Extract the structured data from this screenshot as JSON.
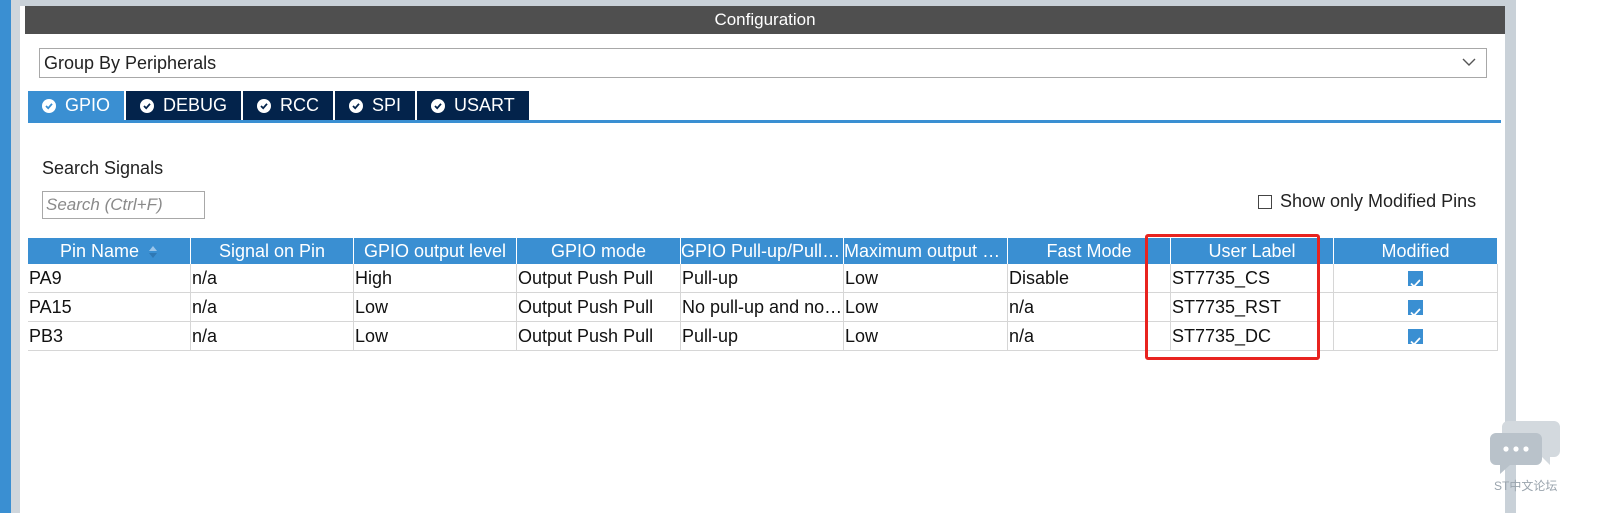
{
  "window": {
    "title": "Configuration"
  },
  "group_select": {
    "value": "Group By Peripherals"
  },
  "tabs": [
    {
      "label": "GPIO",
      "active": true
    },
    {
      "label": "DEBUG",
      "active": false
    },
    {
      "label": "RCC",
      "active": false
    },
    {
      "label": "SPI",
      "active": false
    },
    {
      "label": "USART",
      "active": false
    }
  ],
  "search": {
    "label": "Search Signals",
    "placeholder": "Search (Ctrl+F)"
  },
  "modified_only": {
    "label": "Show only Modified Pins",
    "checked": false
  },
  "table": {
    "columns": [
      "Pin Name",
      "Signal on Pin",
      "GPIO output level",
      "GPIO mode",
      "GPIO Pull-up/Pull-down",
      "Maximum output speed",
      "Fast Mode",
      "User Label",
      "Modified"
    ],
    "rows": [
      {
        "pin": "PA9",
        "signal": "n/a",
        "level": "High",
        "mode": "Output Push Pull",
        "pull": "Pull-up",
        "speed": "Low",
        "fast": "Disable",
        "label": "ST7735_CS",
        "modified": true
      },
      {
        "pin": "PA15",
        "signal": "n/a",
        "level": "Low",
        "mode": "Output Push Pull",
        "pull": "No pull-up and no pull-down",
        "speed": "Low",
        "fast": "n/a",
        "label": "ST7735_RST",
        "modified": true
      },
      {
        "pin": "PB3",
        "signal": "n/a",
        "level": "Low",
        "mode": "Output Push Pull",
        "pull": "Pull-up",
        "speed": "Low",
        "fast": "n/a",
        "label": "ST7735_DC",
        "modified": true
      }
    ]
  },
  "watermark": {
    "text": "ST中文论坛",
    "icon": "chat-bubbles-icon"
  },
  "colors": {
    "accent": "#3a8fd2",
    "tab_dark": "#03234b",
    "titlebar": "#4f4f4f",
    "highlight": "#e8231f"
  }
}
